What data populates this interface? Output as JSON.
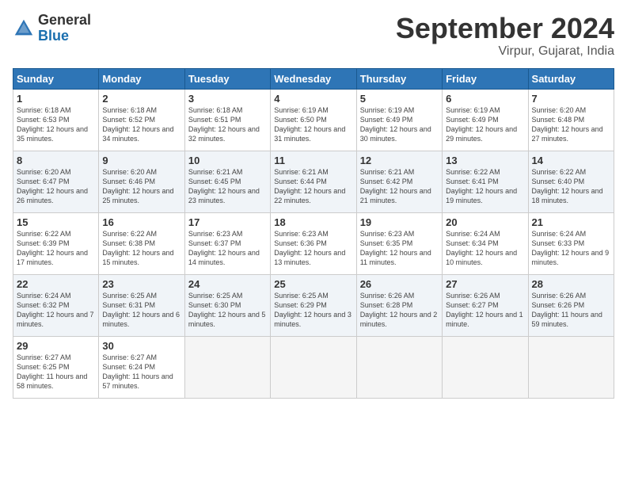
{
  "header": {
    "logo_general": "General",
    "logo_blue": "Blue",
    "month_title": "September 2024",
    "subtitle": "Virpur, Gujarat, India"
  },
  "weekdays": [
    "Sunday",
    "Monday",
    "Tuesday",
    "Wednesday",
    "Thursday",
    "Friday",
    "Saturday"
  ],
  "weeks": [
    [
      {
        "day": "1",
        "sunrise": "6:18 AM",
        "sunset": "6:53 PM",
        "daylight": "12 hours and 35 minutes."
      },
      {
        "day": "2",
        "sunrise": "6:18 AM",
        "sunset": "6:52 PM",
        "daylight": "12 hours and 34 minutes."
      },
      {
        "day": "3",
        "sunrise": "6:18 AM",
        "sunset": "6:51 PM",
        "daylight": "12 hours and 32 minutes."
      },
      {
        "day": "4",
        "sunrise": "6:19 AM",
        "sunset": "6:50 PM",
        "daylight": "12 hours and 31 minutes."
      },
      {
        "day": "5",
        "sunrise": "6:19 AM",
        "sunset": "6:49 PM",
        "daylight": "12 hours and 30 minutes."
      },
      {
        "day": "6",
        "sunrise": "6:19 AM",
        "sunset": "6:49 PM",
        "daylight": "12 hours and 29 minutes."
      },
      {
        "day": "7",
        "sunrise": "6:20 AM",
        "sunset": "6:48 PM",
        "daylight": "12 hours and 27 minutes."
      }
    ],
    [
      {
        "day": "8",
        "sunrise": "6:20 AM",
        "sunset": "6:47 PM",
        "daylight": "12 hours and 26 minutes."
      },
      {
        "day": "9",
        "sunrise": "6:20 AM",
        "sunset": "6:46 PM",
        "daylight": "12 hours and 25 minutes."
      },
      {
        "day": "10",
        "sunrise": "6:21 AM",
        "sunset": "6:45 PM",
        "daylight": "12 hours and 23 minutes."
      },
      {
        "day": "11",
        "sunrise": "6:21 AM",
        "sunset": "6:44 PM",
        "daylight": "12 hours and 22 minutes."
      },
      {
        "day": "12",
        "sunrise": "6:21 AM",
        "sunset": "6:42 PM",
        "daylight": "12 hours and 21 minutes."
      },
      {
        "day": "13",
        "sunrise": "6:22 AM",
        "sunset": "6:41 PM",
        "daylight": "12 hours and 19 minutes."
      },
      {
        "day": "14",
        "sunrise": "6:22 AM",
        "sunset": "6:40 PM",
        "daylight": "12 hours and 18 minutes."
      }
    ],
    [
      {
        "day": "15",
        "sunrise": "6:22 AM",
        "sunset": "6:39 PM",
        "daylight": "12 hours and 17 minutes."
      },
      {
        "day": "16",
        "sunrise": "6:22 AM",
        "sunset": "6:38 PM",
        "daylight": "12 hours and 15 minutes."
      },
      {
        "day": "17",
        "sunrise": "6:23 AM",
        "sunset": "6:37 PM",
        "daylight": "12 hours and 14 minutes."
      },
      {
        "day": "18",
        "sunrise": "6:23 AM",
        "sunset": "6:36 PM",
        "daylight": "12 hours and 13 minutes."
      },
      {
        "day": "19",
        "sunrise": "6:23 AM",
        "sunset": "6:35 PM",
        "daylight": "12 hours and 11 minutes."
      },
      {
        "day": "20",
        "sunrise": "6:24 AM",
        "sunset": "6:34 PM",
        "daylight": "12 hours and 10 minutes."
      },
      {
        "day": "21",
        "sunrise": "6:24 AM",
        "sunset": "6:33 PM",
        "daylight": "12 hours and 9 minutes."
      }
    ],
    [
      {
        "day": "22",
        "sunrise": "6:24 AM",
        "sunset": "6:32 PM",
        "daylight": "12 hours and 7 minutes."
      },
      {
        "day": "23",
        "sunrise": "6:25 AM",
        "sunset": "6:31 PM",
        "daylight": "12 hours and 6 minutes."
      },
      {
        "day": "24",
        "sunrise": "6:25 AM",
        "sunset": "6:30 PM",
        "daylight": "12 hours and 5 minutes."
      },
      {
        "day": "25",
        "sunrise": "6:25 AM",
        "sunset": "6:29 PM",
        "daylight": "12 hours and 3 minutes."
      },
      {
        "day": "26",
        "sunrise": "6:26 AM",
        "sunset": "6:28 PM",
        "daylight": "12 hours and 2 minutes."
      },
      {
        "day": "27",
        "sunrise": "6:26 AM",
        "sunset": "6:27 PM",
        "daylight": "12 hours and 1 minute."
      },
      {
        "day": "28",
        "sunrise": "6:26 AM",
        "sunset": "6:26 PM",
        "daylight": "11 hours and 59 minutes."
      }
    ],
    [
      {
        "day": "29",
        "sunrise": "6:27 AM",
        "sunset": "6:25 PM",
        "daylight": "11 hours and 58 minutes."
      },
      {
        "day": "30",
        "sunrise": "6:27 AM",
        "sunset": "6:24 PM",
        "daylight": "11 hours and 57 minutes."
      },
      null,
      null,
      null,
      null,
      null
    ]
  ]
}
